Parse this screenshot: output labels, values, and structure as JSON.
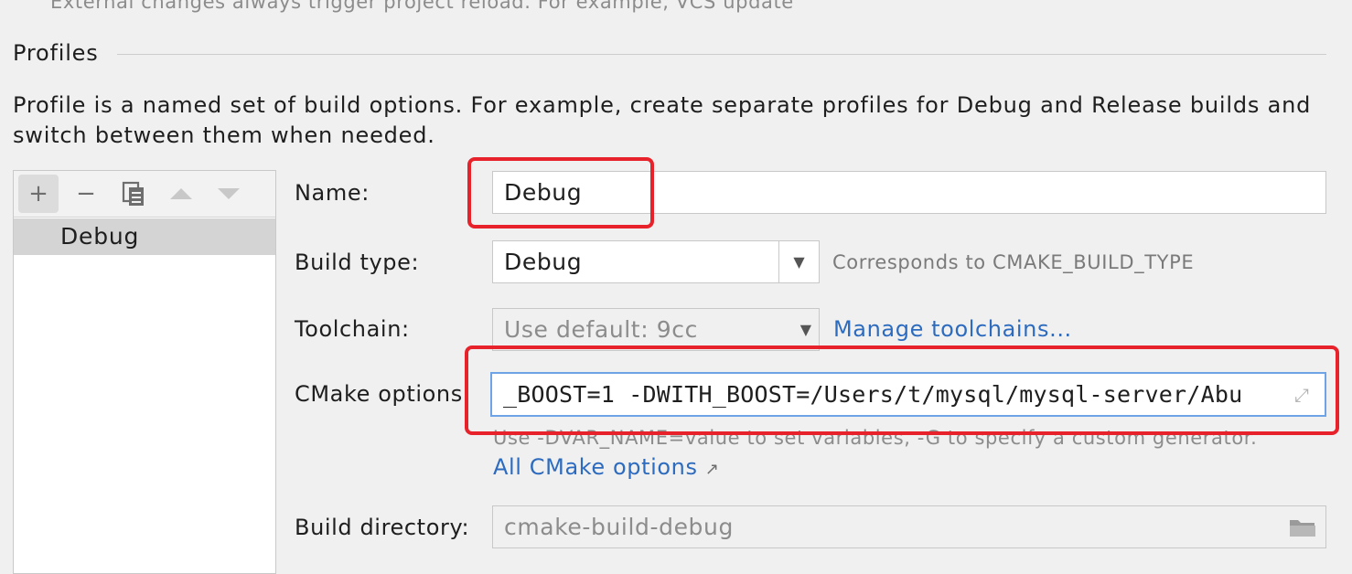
{
  "top_hint": "External changes always trigger project reload. For example, VCS update",
  "section": {
    "title": "Profiles",
    "description": "Profile is a named set of build options. For example, create separate profiles for Debug and Release builds and switch between them when needed."
  },
  "toolbar_icons": [
    "add-icon",
    "remove-icon",
    "copy-icon",
    "move-up-icon",
    "move-down-icon"
  ],
  "profiles": [
    {
      "label": "Debug",
      "selected": true
    }
  ],
  "form": {
    "name": {
      "label": "Name:",
      "value": "Debug"
    },
    "build_type": {
      "label": "Build type:",
      "value": "Debug",
      "note": "Corresponds to CMAKE_BUILD_TYPE"
    },
    "toolchain": {
      "label": "Toolchain:",
      "value": "Use default: 9cc",
      "link": "Manage toolchains..."
    },
    "cmake_options": {
      "label": "CMake options:",
      "value": "_BOOST=1 -DWITH_BOOST=/Users/t/mysql/mysql-server/Abu",
      "hint": "Use -DVAR_NAME=value to set variables, -G to specify a custom generator.",
      "link": "All CMake options",
      "link_icon": "external-link-icon"
    },
    "build_directory": {
      "label": "Build directory:",
      "value": "cmake-build-debug"
    }
  },
  "colors": {
    "highlight": "#e8222b",
    "link": "#2d6bbf",
    "focus_border": "#6ea4e6"
  }
}
